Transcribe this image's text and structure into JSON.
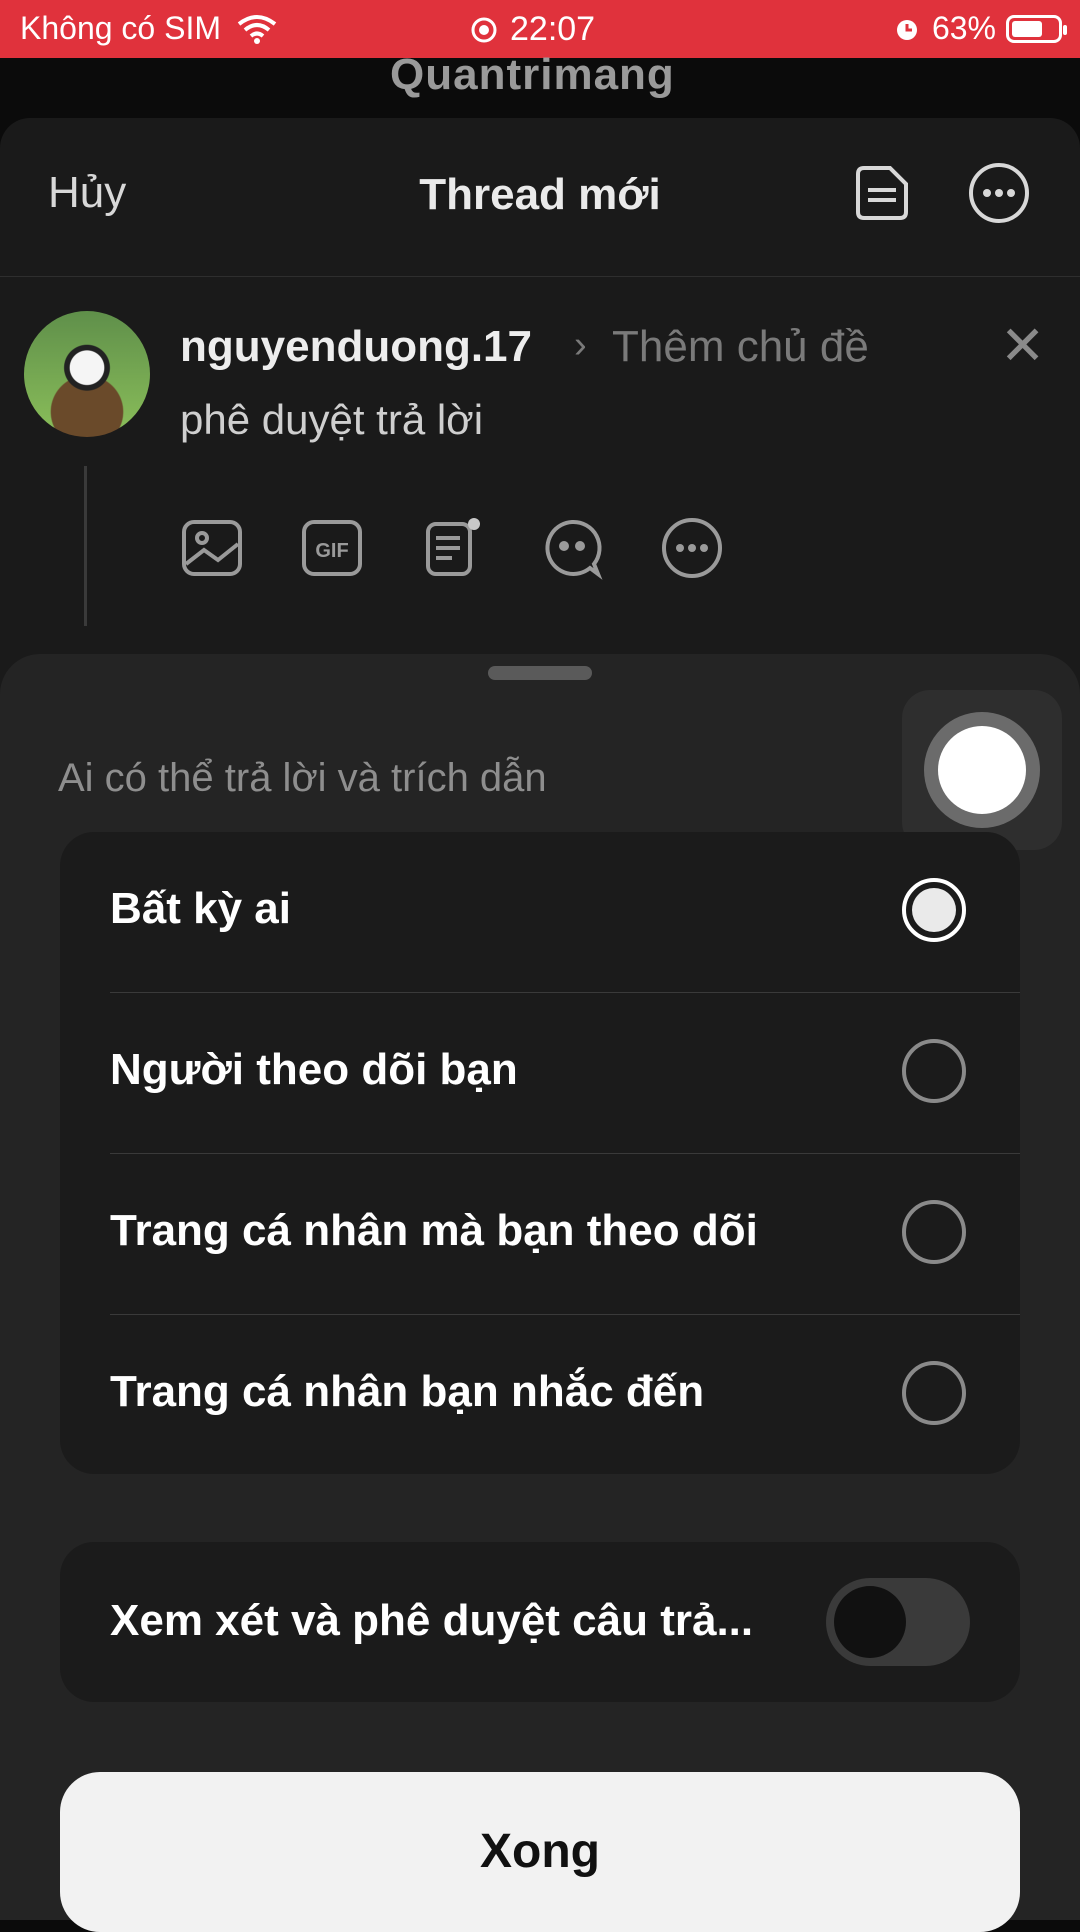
{
  "status_bar": {
    "carrier": "Không có SIM",
    "time": "22:07",
    "battery": "63%"
  },
  "watermark": "Quantrimang",
  "composer": {
    "cancel": "Hủy",
    "title": "Thread mới",
    "username": "nguyenduong.17",
    "topic": "Thêm chủ đề",
    "post_text": "phê duyệt trả lời",
    "tools": [
      "image-icon",
      "gif-icon",
      "notes-icon",
      "quote-icon",
      "more-icon"
    ]
  },
  "sheet": {
    "label": "Ai có thể trả lời và trích dẫn",
    "options": [
      {
        "label": "Bất kỳ ai",
        "selected": true
      },
      {
        "label": "Người theo dõi bạn",
        "selected": false
      },
      {
        "label": "Trang cá nhân mà bạn theo dõi",
        "selected": false
      },
      {
        "label": "Trang cá nhân bạn nhắc đến",
        "selected": false
      }
    ],
    "review_label": "Xem xét và phê duyệt câu trả...",
    "review_enabled": false,
    "done": "Xong"
  }
}
